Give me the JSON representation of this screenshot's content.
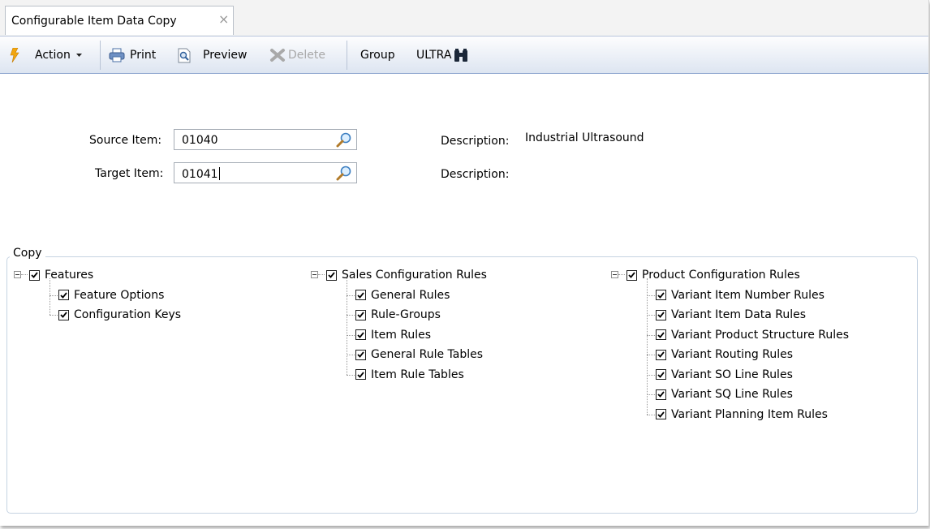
{
  "tab": {
    "title": "Configurable Item Data Copy",
    "close_glyph": "×"
  },
  "toolbar": {
    "action_label": "Action",
    "print_label": "Print",
    "preview_label": "Preview",
    "delete_label": "Delete",
    "group_label": "Group",
    "ultra_label": "ULTRA"
  },
  "form": {
    "source_label": "Source Item:",
    "source_value": "01040",
    "target_label": "Target Item:",
    "target_value": "01041",
    "source_desc_label": "Description:",
    "source_desc_value": "Industrial Ultrasound",
    "target_desc_label": "Description:",
    "target_desc_value": ""
  },
  "copy": {
    "label": "Copy",
    "trees": [
      {
        "label": "Features",
        "checked": true,
        "children": [
          {
            "label": "Feature Options",
            "checked": true
          },
          {
            "label": "Configuration Keys",
            "checked": true
          }
        ]
      },
      {
        "label": "Sales Configuration Rules",
        "checked": true,
        "children": [
          {
            "label": "General Rules",
            "checked": true
          },
          {
            "label": "Rule-Groups",
            "checked": true
          },
          {
            "label": "Item Rules",
            "checked": true
          },
          {
            "label": "General Rule Tables",
            "checked": true
          },
          {
            "label": "Item Rule Tables",
            "checked": true
          }
        ]
      },
      {
        "label": "Product Configuration Rules",
        "checked": true,
        "children": [
          {
            "label": "Variant Item Number Rules",
            "checked": true
          },
          {
            "label": "Variant Item Data Rules",
            "checked": true
          },
          {
            "label": "Variant Product Structure Rules",
            "checked": true
          },
          {
            "label": "Variant Routing Rules",
            "checked": true
          },
          {
            "label": "Variant SO Line Rules",
            "checked": true
          },
          {
            "label": "Variant SQ Line Rules",
            "checked": true
          },
          {
            "label": "Variant Planning Item Rules",
            "checked": true
          }
        ]
      }
    ]
  }
}
